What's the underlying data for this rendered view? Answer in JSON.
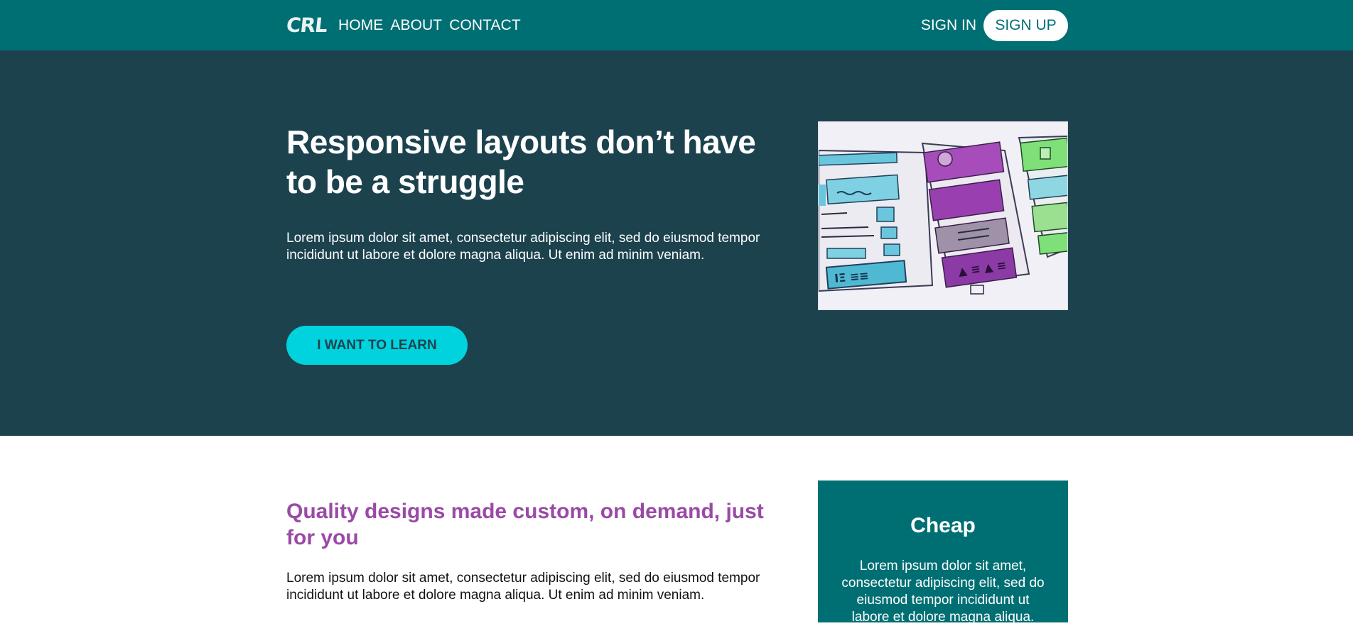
{
  "navbar": {
    "logo": "CRL",
    "links": [
      "HOME",
      "ABOUT",
      "CONTACT"
    ],
    "signin_label": "SIGN IN",
    "signup_label": "SIGN UP"
  },
  "hero": {
    "title": "Responsive layouts don’t have to be a struggle",
    "text": "Lorem ipsum dolor sit amet, consectetur adipiscing elit, sed do eiusmod tempor incididunt ut labore et dolore magna aliqua. Ut enim ad minim veniam.",
    "cta_label": "I WANT TO LEARN",
    "image_icon": "wireframe-sketch-image"
  },
  "features": {
    "title": "Quality designs made custom, on demand, just for you",
    "text": "Lorem ipsum dolor sit amet, consectetur adipiscing elit, sed do eiusmod tempor incididunt ut labore et dolore magna aliqua. Ut enim ad minim veniam.",
    "card": {
      "title": "Cheap",
      "text": "Lorem ipsum dolor sit amet, consectetur adipiscing elit, sed do eiusmod tempor incididunt ut labore et dolore magna aliqua."
    }
  },
  "colors": {
    "nav_bg": "#006f73",
    "hero_bg": "#1c424e",
    "accent_cyan": "#00d3de",
    "heading_purple": "#9a4aa6"
  }
}
